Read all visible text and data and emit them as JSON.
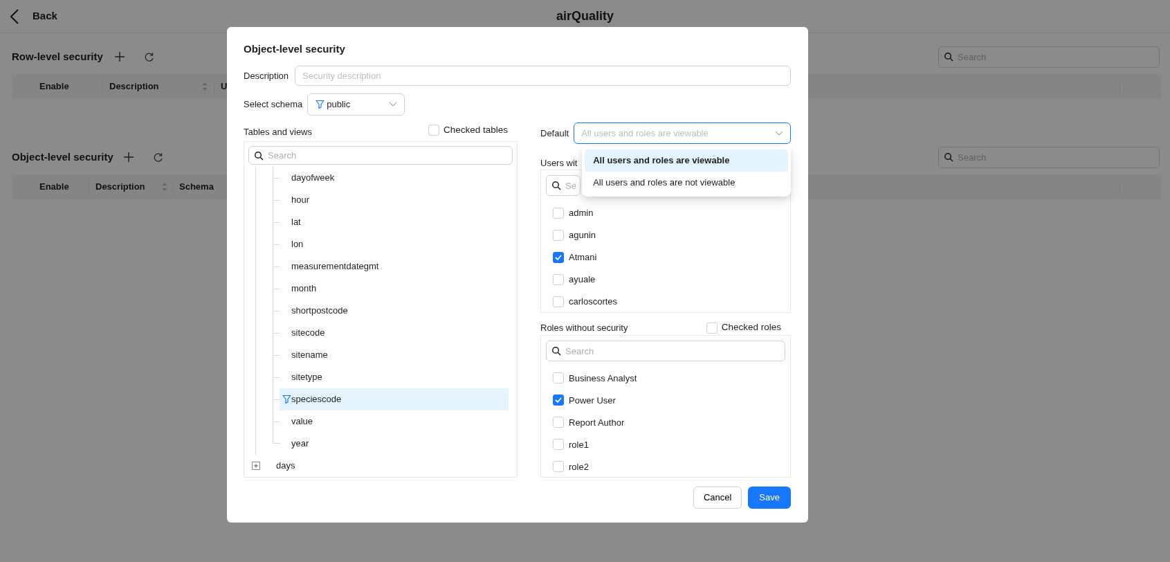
{
  "header": {
    "back_label": "Back",
    "title": "airQuality"
  },
  "sections": [
    {
      "title": "Row-level security",
      "search": {
        "placeholder": "Search"
      },
      "columns": [
        {
          "label": "Enable",
          "sortable": false
        },
        {
          "label": "Description",
          "sortable": true
        },
        {
          "label": "U",
          "sortable": false
        }
      ]
    },
    {
      "title": "Object-level security",
      "search": {
        "placeholder": "Search"
      },
      "columns": [
        {
          "label": "Enable",
          "sortable": false
        },
        {
          "label": "Description",
          "sortable": true
        },
        {
          "label": "Schema",
          "sortable": false
        }
      ]
    }
  ],
  "dialog": {
    "title": "Object-level security",
    "description": {
      "label": "Description",
      "placeholder": "Security description"
    },
    "schema": {
      "label": "Select schema",
      "value": "public"
    },
    "tables": {
      "label": "Tables and views",
      "checked_filter": {
        "label": "Checked tables",
        "checked": false
      },
      "search": {
        "placeholder": "Search"
      },
      "columns": [
        {
          "label": "dayofweek",
          "selected": false,
          "filtered": false
        },
        {
          "label": "hour",
          "selected": false,
          "filtered": false
        },
        {
          "label": "lat",
          "selected": false,
          "filtered": false
        },
        {
          "label": "lon",
          "selected": false,
          "filtered": false
        },
        {
          "label": "measurementdategmt",
          "selected": false,
          "filtered": false
        },
        {
          "label": "month",
          "selected": false,
          "filtered": false
        },
        {
          "label": "shortpostcode",
          "selected": false,
          "filtered": false
        },
        {
          "label": "sitecode",
          "selected": false,
          "filtered": false
        },
        {
          "label": "sitename",
          "selected": false,
          "filtered": false
        },
        {
          "label": "sitetype",
          "selected": false,
          "filtered": false
        },
        {
          "label": "speciescode",
          "selected": true,
          "filtered": true
        },
        {
          "label": "value",
          "selected": false,
          "filtered": false
        },
        {
          "label": "year",
          "selected": false,
          "filtered": false
        }
      ],
      "tables": [
        {
          "label": "days",
          "expanded": false
        }
      ]
    },
    "default": {
      "label": "Default",
      "placeholder": "All users and roles are viewable",
      "open": true,
      "options": [
        {
          "label": "All users and roles are viewable",
          "selected": true
        },
        {
          "label": "All users and roles are not viewable",
          "selected": false
        }
      ]
    },
    "users": {
      "label": "Users wit",
      "search": {
        "placeholder": "Se"
      },
      "items": [
        {
          "label": "admin",
          "checked": false
        },
        {
          "label": "agunin",
          "checked": false
        },
        {
          "label": "Atmani",
          "checked": true
        },
        {
          "label": "ayuale",
          "checked": false
        },
        {
          "label": "carloscortes",
          "checked": false
        }
      ]
    },
    "roles": {
      "label": "Roles without security",
      "checked_filter": {
        "label": "Checked roles",
        "checked": false
      },
      "search": {
        "placeholder": "Search"
      },
      "items": [
        {
          "label": "Business Analyst",
          "checked": false
        },
        {
          "label": "Power User",
          "checked": true
        },
        {
          "label": "Report Author",
          "checked": false
        },
        {
          "label": "role1",
          "checked": false
        },
        {
          "label": "role2",
          "checked": false
        }
      ]
    },
    "buttons": [
      {
        "label": "Cancel",
        "kind": "secondary"
      },
      {
        "label": "Save",
        "kind": "primary"
      }
    ]
  }
}
